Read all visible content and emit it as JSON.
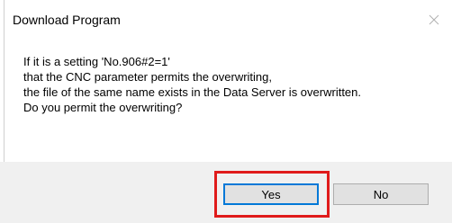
{
  "window": {
    "title": "Download Program",
    "close_icon": "close-icon"
  },
  "message": {
    "lines": [
      "If it is a setting 'No.906#2=1'",
      "that the CNC parameter permits the overwriting,",
      "the file of the same name exists in the Data Server is overwritten.",
      "Do you permit the overwriting?"
    ]
  },
  "buttons": {
    "yes": "Yes",
    "no": "No"
  },
  "colors": {
    "highlight": "#e01b1b",
    "focus_border": "#0078d7",
    "footer_bg": "#f0f0f0",
    "button_bg": "#e1e1e1"
  }
}
